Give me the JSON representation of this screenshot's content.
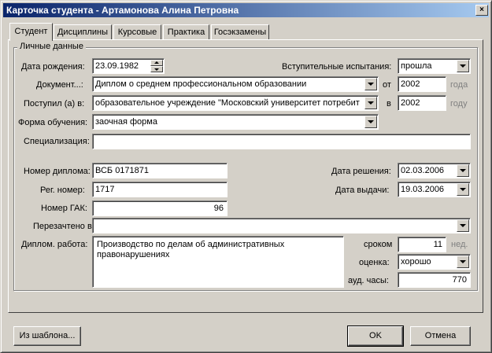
{
  "window": {
    "title": "Карточка студента - Артамонова Алина Петровна",
    "close_glyph": "×"
  },
  "tabs": [
    {
      "label": "Студент",
      "active": true
    },
    {
      "label": "Дисциплины",
      "active": false
    },
    {
      "label": "Курсовые",
      "active": false
    },
    {
      "label": "Практика",
      "active": false
    },
    {
      "label": "Госэкзамены",
      "active": false
    }
  ],
  "group": {
    "legend": "Личные данные"
  },
  "form": {
    "birth_date": {
      "label": "Дата рождения:",
      "value": "23.09.1982"
    },
    "entrance": {
      "label": "Вступительные испытания:",
      "value": "прошла"
    },
    "document": {
      "label": "Документ...:",
      "value": "Диплом о среднем профессиональном образовании",
      "from_label": "от",
      "year": "2002",
      "year_suffix": "года"
    },
    "admitted": {
      "label": "Поступил (а) в:",
      "value": "образовательное учреждение \"Московский университет потребит",
      "in_label": "в",
      "year": "2002",
      "year_suffix": "году"
    },
    "study_form": {
      "label": "Форма обучения:",
      "value": "заочная форма"
    },
    "specialization": {
      "label": "Специализация:",
      "value": ""
    },
    "diploma_number": {
      "label": "Номер диплома:",
      "value": "ВСБ 0171871"
    },
    "decision_date": {
      "label": "Дата решения:",
      "value": "02.03.2006"
    },
    "reg_number": {
      "label": "Рег. номер:",
      "value": "1717"
    },
    "issue_date": {
      "label": "Дата выдачи:",
      "value": "19.03.2006"
    },
    "gak_number": {
      "label": "Номер ГАК:",
      "value": "96"
    },
    "transferred": {
      "label": "Перезачтено в:",
      "value": ""
    },
    "thesis": {
      "label": "Диплом. работа:",
      "value": "Производство по делам об административных правонарушениях"
    },
    "term": {
      "label": "сроком",
      "value": "11",
      "unit": "нед."
    },
    "grade": {
      "label": "оценка:",
      "value": "хорошо"
    },
    "aud_hours": {
      "label": "ауд. часы:",
      "value": "770"
    }
  },
  "buttons": {
    "template": "Из шаблона...",
    "ok": "OK",
    "cancel": "Отмена"
  }
}
